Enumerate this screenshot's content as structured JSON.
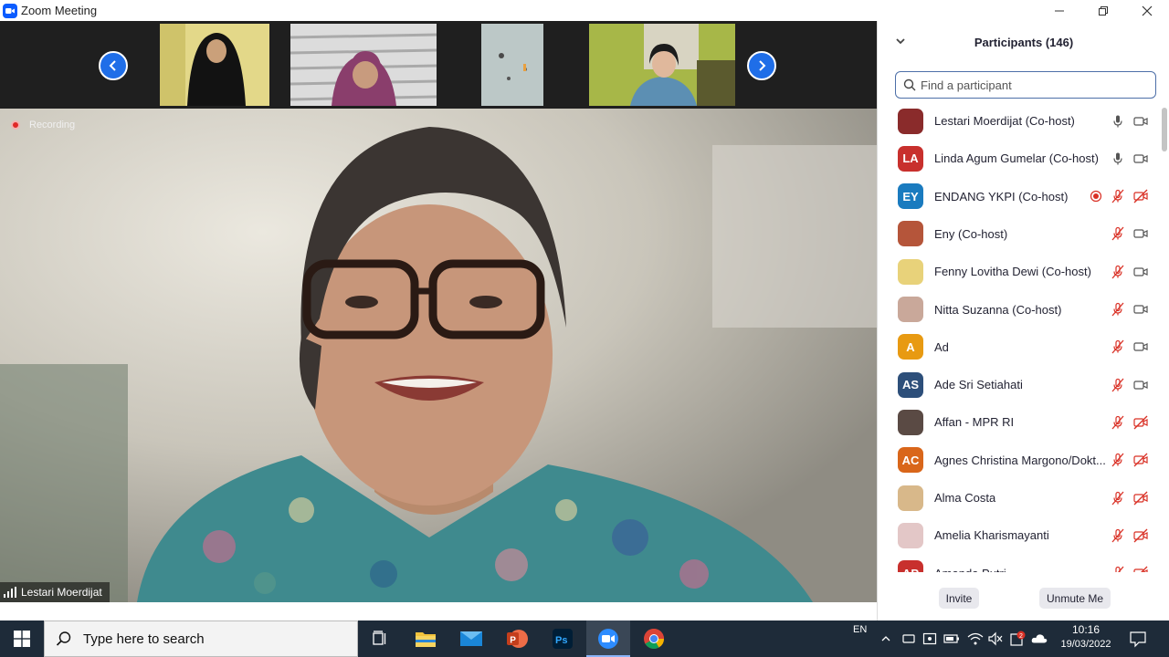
{
  "window": {
    "title": "Zoom Meeting"
  },
  "video": {
    "recording_label": "Recording",
    "speaker_name": "Lestari Moerdijat"
  },
  "participants": {
    "header": "Participants (146)",
    "search_placeholder": "Find a participant",
    "list": [
      {
        "name": "Lestari Moerdijat (Co-host)",
        "initials": "",
        "avatar_color": "#8a2b2b",
        "mic": "on",
        "video": "on",
        "recording": false
      },
      {
        "name": "Linda Agum Gumelar (Co-host)",
        "initials": "LA",
        "avatar_color": "#c8302d",
        "mic": "on",
        "video": "on",
        "recording": false
      },
      {
        "name": "ENDANG YKPI (Co-host)",
        "initials": "EY",
        "avatar_color": "#1a7bbf",
        "mic": "off",
        "video": "off",
        "recording": true
      },
      {
        "name": "Eny (Co-host)",
        "initials": "",
        "avatar_color": "#b5553a",
        "mic": "off",
        "video": "on",
        "recording": false
      },
      {
        "name": "Fenny Lovitha Dewi (Co-host)",
        "initials": "",
        "avatar_color": "#e8d27a",
        "mic": "off",
        "video": "on",
        "recording": false
      },
      {
        "name": "Nitta Suzanna (Co-host)",
        "initials": "",
        "avatar_color": "#c9a89a",
        "mic": "off",
        "video": "on",
        "recording": false
      },
      {
        "name": "Ad",
        "initials": "A",
        "avatar_color": "#e89a12",
        "mic": "off",
        "video": "on",
        "recording": false
      },
      {
        "name": "Ade Sri Setiahati",
        "initials": "AS",
        "avatar_color": "#2d4f7a",
        "mic": "off",
        "video": "on",
        "recording": false
      },
      {
        "name": "Affan - MPR RI",
        "initials": "",
        "avatar_color": "#5a4a44",
        "mic": "off",
        "video": "off",
        "recording": false
      },
      {
        "name": "Agnes Christina Margono/Dokt...",
        "initials": "AC",
        "avatar_color": "#d9661a",
        "mic": "off",
        "video": "off",
        "recording": false
      },
      {
        "name": "Alma Costa",
        "initials": "",
        "avatar_color": "#d8b88a",
        "mic": "off",
        "video": "off",
        "recording": false
      },
      {
        "name": "Amelia Kharismayanti",
        "initials": "",
        "avatar_color": "#e3c7c7",
        "mic": "off",
        "video": "off",
        "recording": false
      },
      {
        "name": "Amanda Putri",
        "initials": "AP",
        "avatar_color": "#c8302d",
        "mic": "off",
        "video": "off",
        "recording": false
      }
    ],
    "invite_label": "Invite",
    "unmute_me_label": "Unmute Me"
  },
  "taskbar": {
    "search_placeholder": "Type here to search",
    "language": "EN",
    "time": "10:16",
    "date": "19/03/2022",
    "notification_count": "2"
  },
  "colors": {
    "accent": "#0b5cff",
    "muted_red": "#d93025",
    "taskbar": "#1e2b39"
  }
}
